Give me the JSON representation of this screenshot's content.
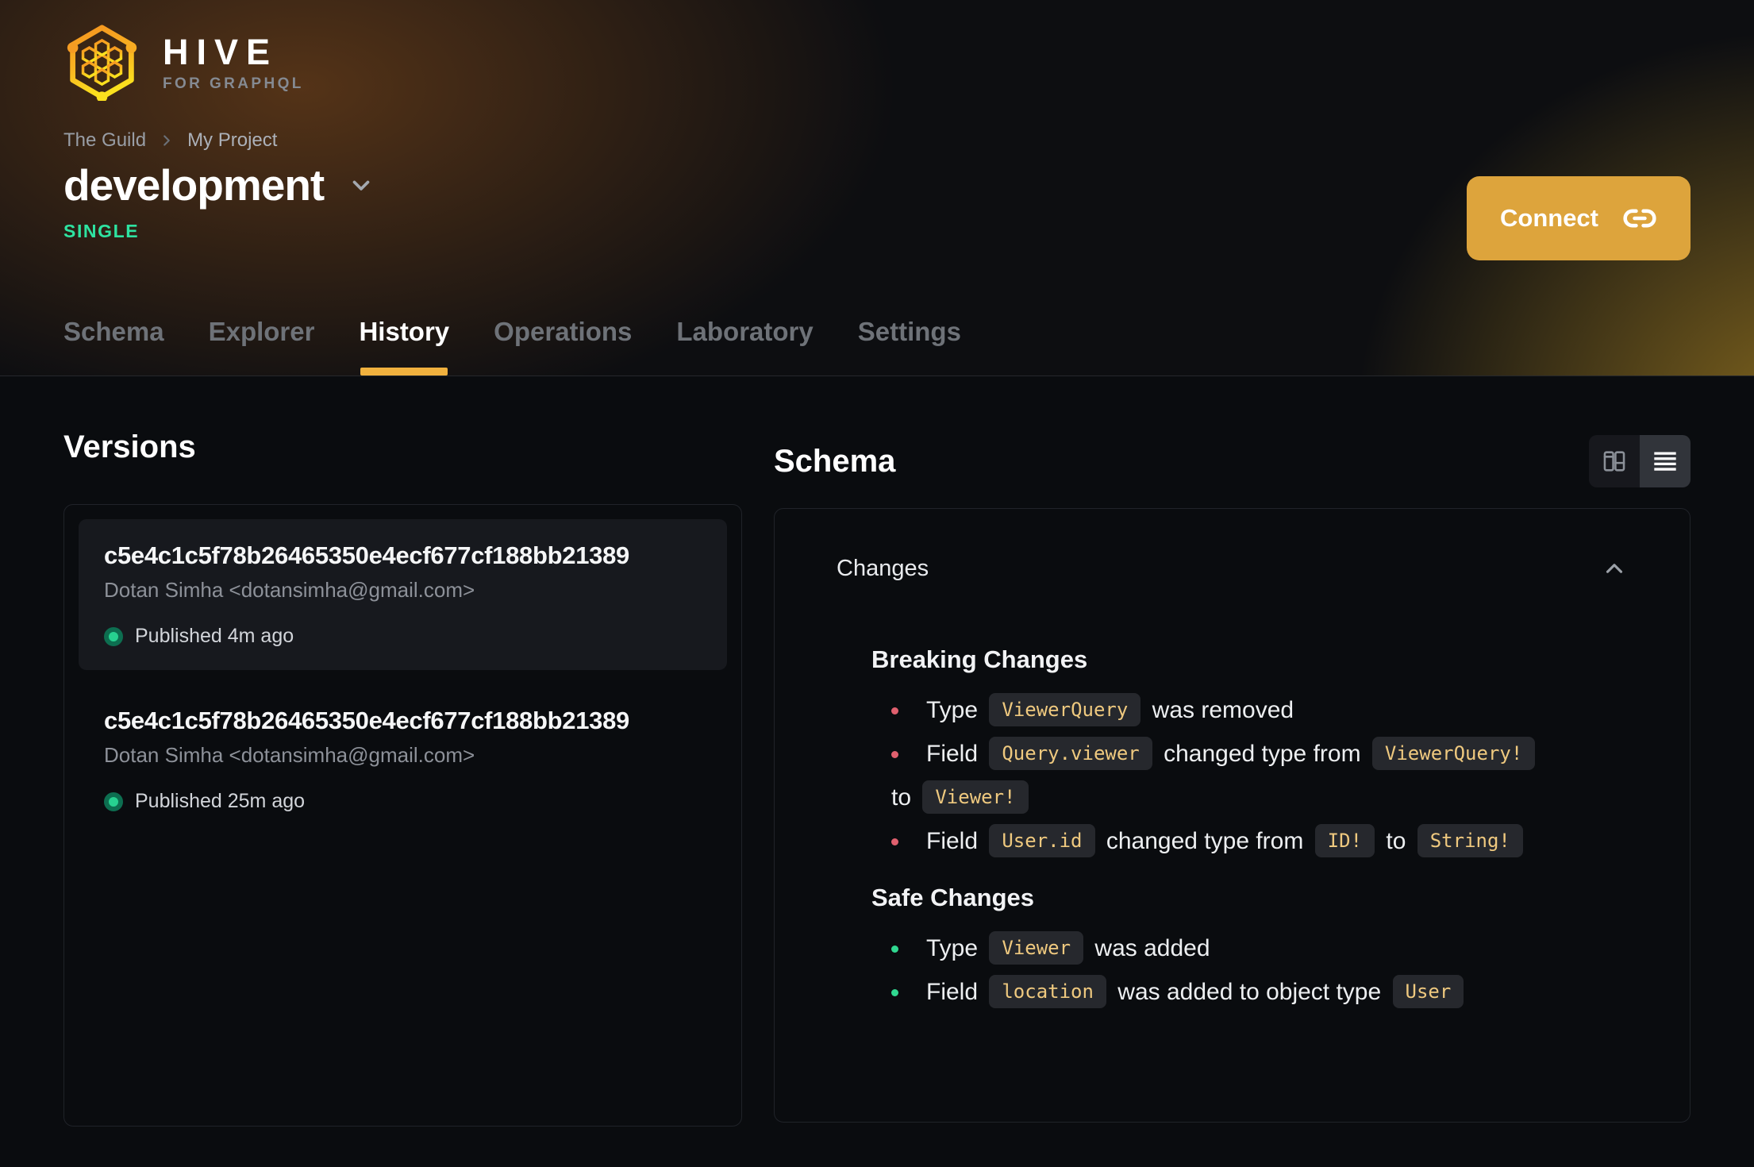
{
  "header": {
    "logo": {
      "title": "HIVE",
      "subtitle": "FOR GRAPHQL",
      "icon": "hive-honeycomb-icon"
    },
    "breadcrumb": {
      "items": [
        "The Guild",
        "My Project"
      ],
      "separator_icon": "chevron-right-icon"
    },
    "target": {
      "name": "development",
      "badge": "SINGLE",
      "dropdown_icon": "chevron-down-icon"
    },
    "connect": {
      "label": "Connect",
      "icon": "link-icon"
    },
    "tabs": [
      {
        "label": "Schema",
        "active": false
      },
      {
        "label": "Explorer",
        "active": false
      },
      {
        "label": "History",
        "active": true
      },
      {
        "label": "Operations",
        "active": false
      },
      {
        "label": "Laboratory",
        "active": false
      },
      {
        "label": "Settings",
        "active": false
      }
    ]
  },
  "versions": {
    "heading": "Versions",
    "items": [
      {
        "hash": "c5e4c1c5f78b26465350e4ecf677cf188bb21389",
        "author": "Dotan Simha <dotansimha@gmail.com>",
        "status": "Published 4m ago",
        "status_icon": "green-dot-icon",
        "highlighted": true
      },
      {
        "hash": "c5e4c1c5f78b26465350e4ecf677cf188bb21389",
        "author": "Dotan Simha <dotansimha@gmail.com>",
        "status": "Published 25m ago",
        "status_icon": "green-dot-icon",
        "highlighted": false
      }
    ]
  },
  "schema_panel": {
    "heading": "Schema",
    "view_toggle": {
      "options": [
        {
          "name": "split-view",
          "icon": "split-view-icon",
          "active": false
        },
        {
          "name": "list-view",
          "icon": "list-view-icon",
          "active": true
        }
      ]
    },
    "changes": {
      "title": "Changes",
      "collapse_icon": "chevron-up-icon",
      "sections": [
        {
          "title": "Breaking Changes",
          "severity": "breaking",
          "items": [
            [
              {
                "text": "Type "
              },
              {
                "code": "ViewerQuery"
              },
              {
                "text": " was removed"
              }
            ],
            [
              {
                "text": "Field "
              },
              {
                "code": "Query.viewer"
              },
              {
                "text": " changed type from "
              },
              {
                "code": "ViewerQuery!"
              },
              {
                "group": [
                  {
                    "text": " to "
                  },
                  {
                    "code": "Viewer!"
                  }
                ]
              }
            ],
            [
              {
                "text": "Field "
              },
              {
                "code": "User.id"
              },
              {
                "text": " changed type from "
              },
              {
                "code": "ID!"
              },
              {
                "text": " to "
              },
              {
                "code": "String!"
              }
            ]
          ]
        },
        {
          "title": "Safe Changes",
          "severity": "safe",
          "items": [
            [
              {
                "text": "Type "
              },
              {
                "code": "Viewer"
              },
              {
                "text": " was added"
              }
            ],
            [
              {
                "text": "Field "
              },
              {
                "code": "location"
              },
              {
                "text": " was added to object type "
              },
              {
                "code": "User"
              }
            ]
          ]
        }
      ]
    }
  },
  "colors": {
    "accent_yellow": "#dda43c",
    "tab_underline": "#f0b13e",
    "badge_green": "#2ee3a1",
    "status_dot": "#27d190",
    "status_dot_ring": "#0d6e50",
    "breaking_bullet": "#e0606e",
    "safe_bullet": "#30d890",
    "code_text": "#efc97f",
    "code_bg": "#26282d",
    "panel_border": "#202329",
    "background": "#0a0c0f"
  }
}
